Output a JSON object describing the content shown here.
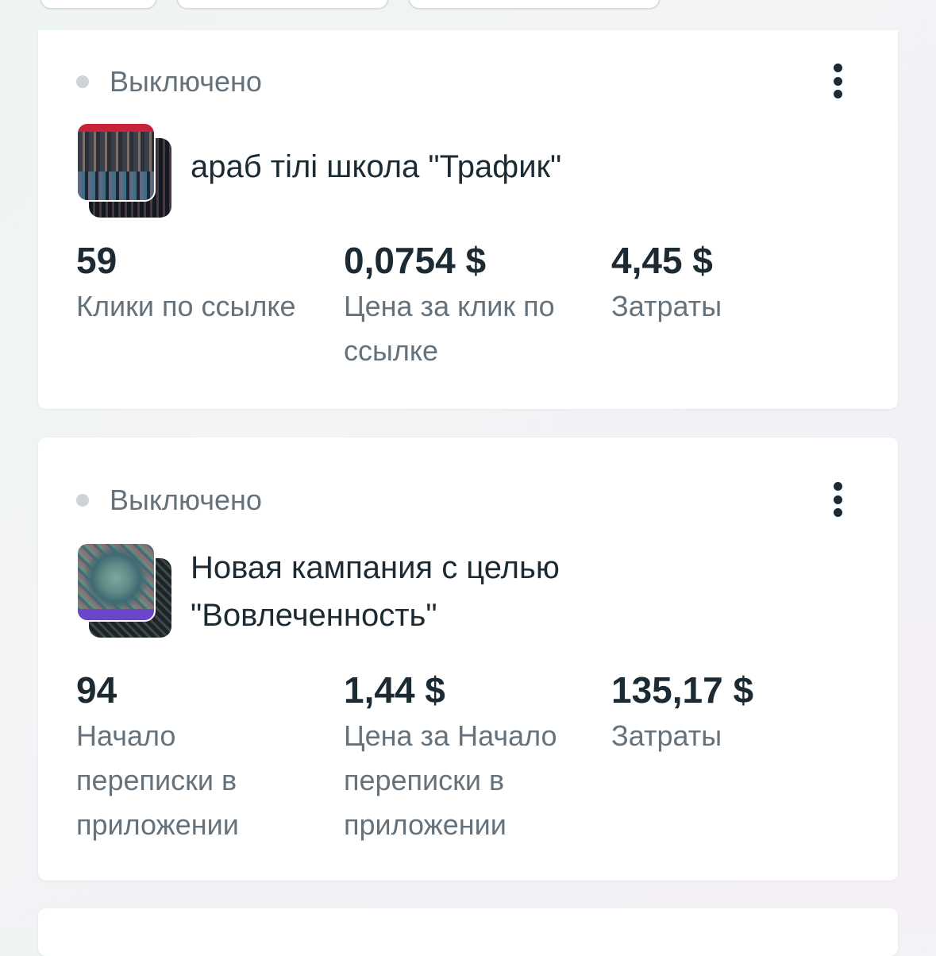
{
  "campaigns": [
    {
      "status": "Выключено",
      "thumbnail": "campaign-image",
      "title": "араб тілі школа \"Трафик\"",
      "metrics": [
        {
          "value": "59",
          "label": "Клики по ссылке"
        },
        {
          "value": "0,0754 $",
          "label": "Цена за клик по ссылке"
        },
        {
          "value": "4,45 $",
          "label": "Затраты"
        }
      ]
    },
    {
      "status": "Выключено",
      "thumbnail": "campaign-image",
      "title": "Новая кампания с целью \"Вовлеченность\"",
      "metrics": [
        {
          "value": "94",
          "label": "Начало переписки в приложении"
        },
        {
          "value": "1,44 $",
          "label": "Цена за Начало переписки в приложении"
        },
        {
          "value": "135,17 $",
          "label": "Затраты"
        }
      ]
    }
  ],
  "icons": {
    "status": "status-dot-icon",
    "menu": "more-vertical-icon"
  },
  "colors": {
    "status_dot": "#cdd3d8",
    "primary_text": "#1c2b33",
    "secondary_text": "#65727c"
  }
}
